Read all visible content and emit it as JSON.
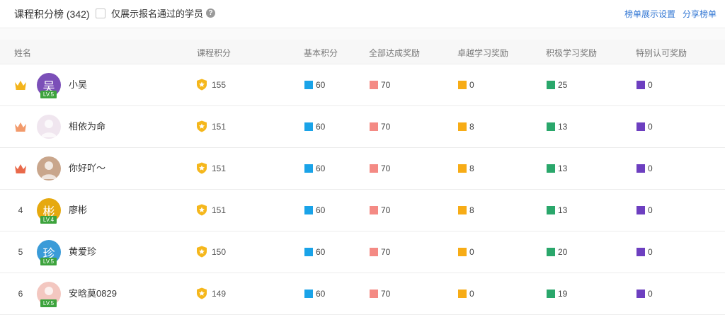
{
  "header": {
    "title": "课程积分榜 (342)",
    "filter_label": "仅展示报名通过的学员",
    "help_icon": "question-icon",
    "links": [
      "榜单展示设置",
      "分享榜单"
    ]
  },
  "colors": {
    "basic": "#1aa3e8",
    "complete": "#f48a84",
    "excellent": "#f7ac16",
    "active": "#2aa76b",
    "special": "#6d3fc0",
    "gold": "#f5b71c"
  },
  "columns": [
    "姓名",
    "课程积分",
    "基本积分",
    "全部达成奖励",
    "卓越学习奖励",
    "积极学习奖励",
    "特别认可奖励"
  ],
  "rows": [
    {
      "rank": "",
      "rank_icon": "gold-crown-icon",
      "name": "小吴",
      "avatar_text": "吴",
      "avatar_color": "#7b4fb8",
      "level": "LV.5",
      "score": "155",
      "basic": "60",
      "complete": "70",
      "excellent": "0",
      "active": "25",
      "special": "0"
    },
    {
      "rank": "",
      "rank_icon": "silver-crown-icon",
      "name": "相依为命",
      "avatar_text": "",
      "avatar_color": "#f0e6ef",
      "level": "",
      "score": "151",
      "basic": "60",
      "complete": "70",
      "excellent": "8",
      "active": "13",
      "special": "0"
    },
    {
      "rank": "",
      "rank_icon": "bronze-crown-icon",
      "name": "你好吖～",
      "avatar_text": "",
      "avatar_color": "#c9a68c",
      "level": "",
      "score": "151",
      "basic": "60",
      "complete": "70",
      "excellent": "8",
      "active": "13",
      "special": "0"
    },
    {
      "rank": "4",
      "rank_icon": "",
      "name": "廖彬",
      "avatar_text": "彬",
      "avatar_color": "#e6a90f",
      "level": "LV.4",
      "score": "151",
      "basic": "60",
      "complete": "70",
      "excellent": "8",
      "active": "13",
      "special": "0"
    },
    {
      "rank": "5",
      "rank_icon": "",
      "name": "黄爱珍",
      "avatar_text": "珍",
      "avatar_color": "#3a9bd8",
      "level": "LV.5",
      "score": "150",
      "basic": "60",
      "complete": "70",
      "excellent": "0",
      "active": "20",
      "special": "0"
    },
    {
      "rank": "6",
      "rank_icon": "",
      "name": "安晗莫0829",
      "avatar_text": "",
      "avatar_color": "#f3c7c0",
      "level": "LV.5",
      "score": "149",
      "basic": "60",
      "complete": "70",
      "excellent": "0",
      "active": "19",
      "special": "0"
    }
  ]
}
